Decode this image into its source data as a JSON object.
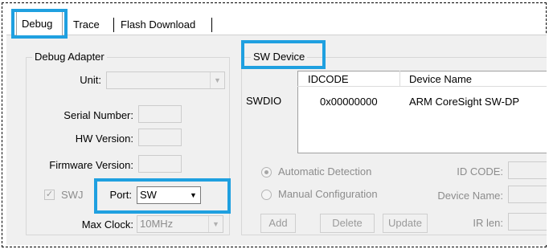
{
  "tabs": [
    {
      "label": "Debug"
    },
    {
      "label": "Trace"
    },
    {
      "label": "Flash Download"
    }
  ],
  "debug_adapter": {
    "title": "Debug Adapter",
    "unit_label": "Unit:",
    "unit_value": "",
    "serial_label": "Serial Number:",
    "hw_label": "HW Version:",
    "fw_label": "Firmware Version:",
    "swj_label": "SWJ",
    "swj_checked": "✓",
    "port_label": "Port:",
    "port_value": "SW",
    "max_clock_label": "Max Clock:",
    "max_clock_value": "10MHz"
  },
  "sw_device": {
    "title": "SW Device",
    "row_label": "SWDIO",
    "columns": [
      "IDCODE",
      "Device Name"
    ],
    "rows": [
      {
        "idcode": "0x00000000",
        "device_name": "ARM CoreSight SW-DP"
      }
    ],
    "auto_detect_label": "Automatic Detection",
    "manual_config_label": "Manual Configuration",
    "id_code_label": "ID CODE:",
    "device_name_label": "Device Name:",
    "ir_len_label": "IR len:",
    "add_label": "Add",
    "delete_label": "Delete",
    "update_label": "Update"
  },
  "colors": {
    "highlight": "#1fa0e0",
    "dialog_bg": "#f0f0f0",
    "disabled_text": "#8c8c8c"
  }
}
